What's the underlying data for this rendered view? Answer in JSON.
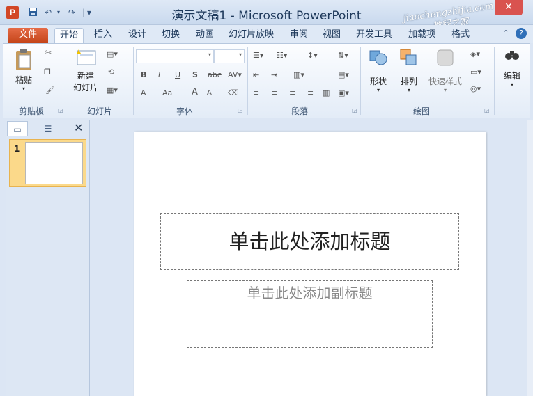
{
  "window": {
    "title": "演示文稿1 - Microsoft PowerPoint",
    "app_icon_letter": "P",
    "minimize": "－",
    "close": "✕"
  },
  "qat": {
    "save": "💾",
    "undo": "↶",
    "redo": "↷",
    "customize": "▾"
  },
  "watermark": {
    "line1": "jiaochengzhijia.com",
    "line2": "教程之家"
  },
  "tabs": [
    "文件",
    "开始",
    "插入",
    "设计",
    "切换",
    "动画",
    "幻灯片放映",
    "审阅",
    "视图",
    "开发工具",
    "加载项",
    "格式",
    "帮助提要"
  ],
  "ribbon": {
    "clipboard": {
      "label": "剪贴板",
      "paste": "粘贴"
    },
    "slides": {
      "label": "幻灯片",
      "new_slide_1": "新建",
      "new_slide_2": "幻灯片"
    },
    "font": {
      "label": "字体",
      "bold": "B",
      "italic": "I",
      "underline": "U",
      "strike": "S",
      "abc": "abc",
      "grow": "A",
      "shrink": "A",
      "aa": "Aa",
      "color_a": "A"
    },
    "paragraph": {
      "label": "段落"
    },
    "drawing": {
      "label": "绘图",
      "shapes": "形状",
      "arrange": "排列",
      "quick_styles": "快速样式"
    },
    "editing": {
      "label": "编辑"
    }
  },
  "left_pane": {
    "tab1": "▭",
    "tab2": "☰",
    "close": "✕",
    "slide_number": "1"
  },
  "slide": {
    "title_placeholder": "单击此处添加标题",
    "subtitle_placeholder": "单击此处添加副标题"
  },
  "colors": {
    "accent": "#d24726",
    "ribbon_bg": "#e3ecf7",
    "workspace": "#dce6f4"
  }
}
